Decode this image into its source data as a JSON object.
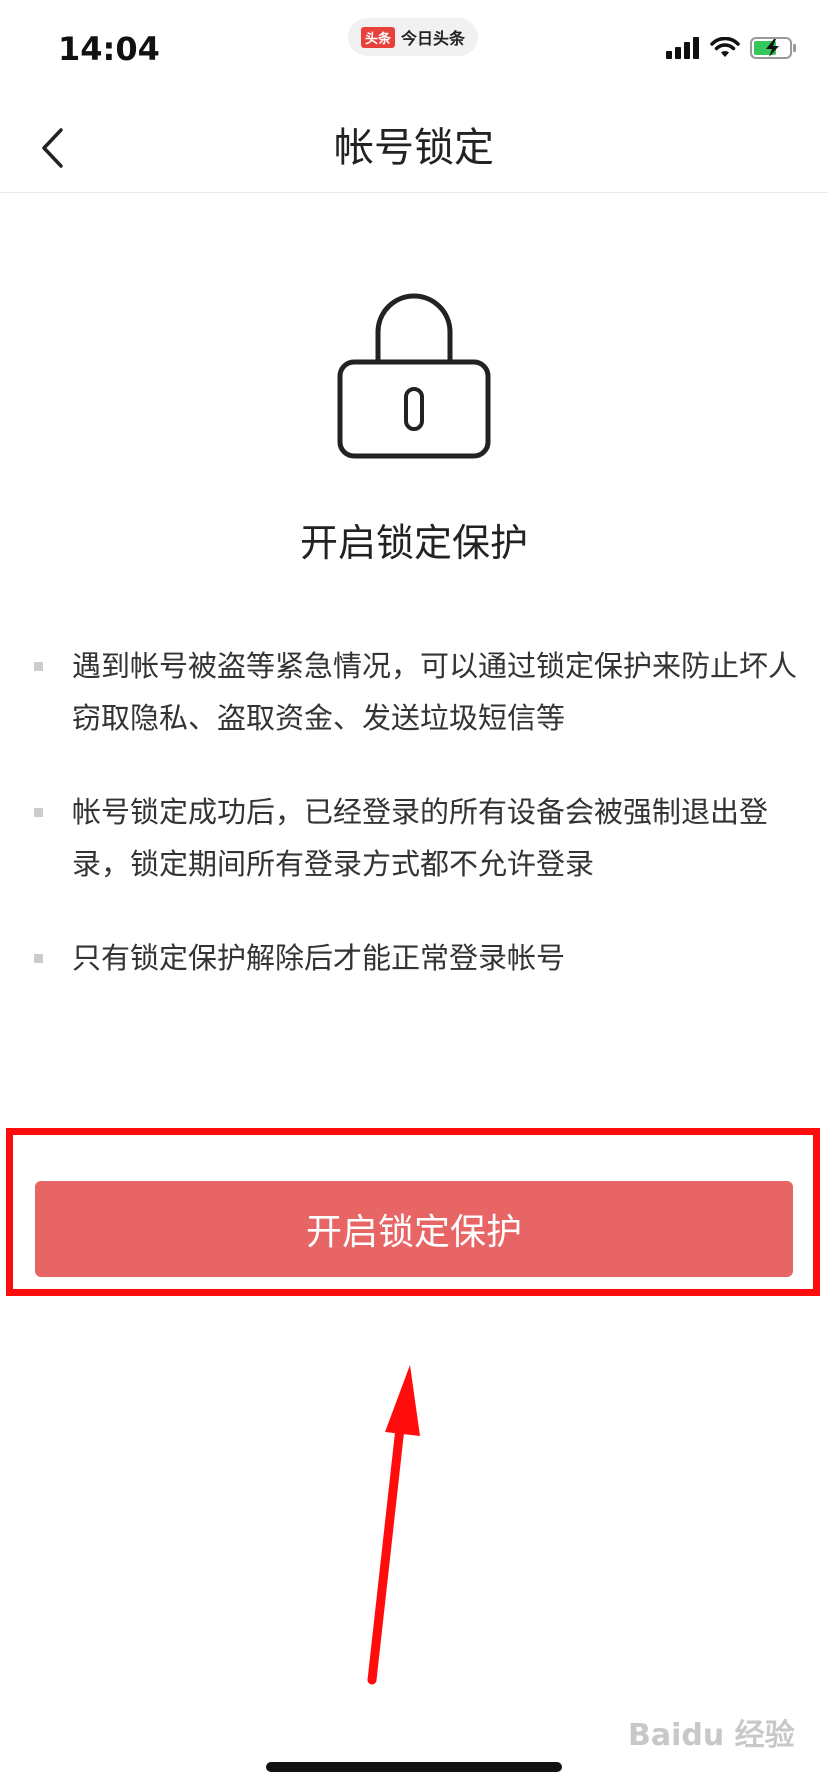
{
  "status_bar": {
    "time": "14:04",
    "app_logo": "头条",
    "app_name": "今日头条",
    "icons": [
      "signal-icon",
      "wifi-icon",
      "battery-charging-icon"
    ]
  },
  "nav": {
    "back_icon": "chevron-left-icon",
    "title": "帐号锁定"
  },
  "illustration": {
    "icon": "lock-icon"
  },
  "headline": "开启锁定保护",
  "bullets": [
    "遇到帐号被盗等紧急情况，可以通过锁定保护来防止坏人窃取隐私、盗取资金、发送垃圾短信等",
    "帐号锁定成功后，已经登录的所有设备会被强制退出登录，锁定期间所有登录方式都不允许登录",
    "只有锁定保护解除后才能正常登录帐号"
  ],
  "primary_button": {
    "label": "开启锁定保护"
  },
  "annotation": {
    "highlight_color": "#ff0d0d",
    "arrow_color": "#ff0d0d"
  },
  "colors": {
    "button": "#e86565",
    "accent": "#e8403a"
  },
  "watermark": "Baidu 经验"
}
